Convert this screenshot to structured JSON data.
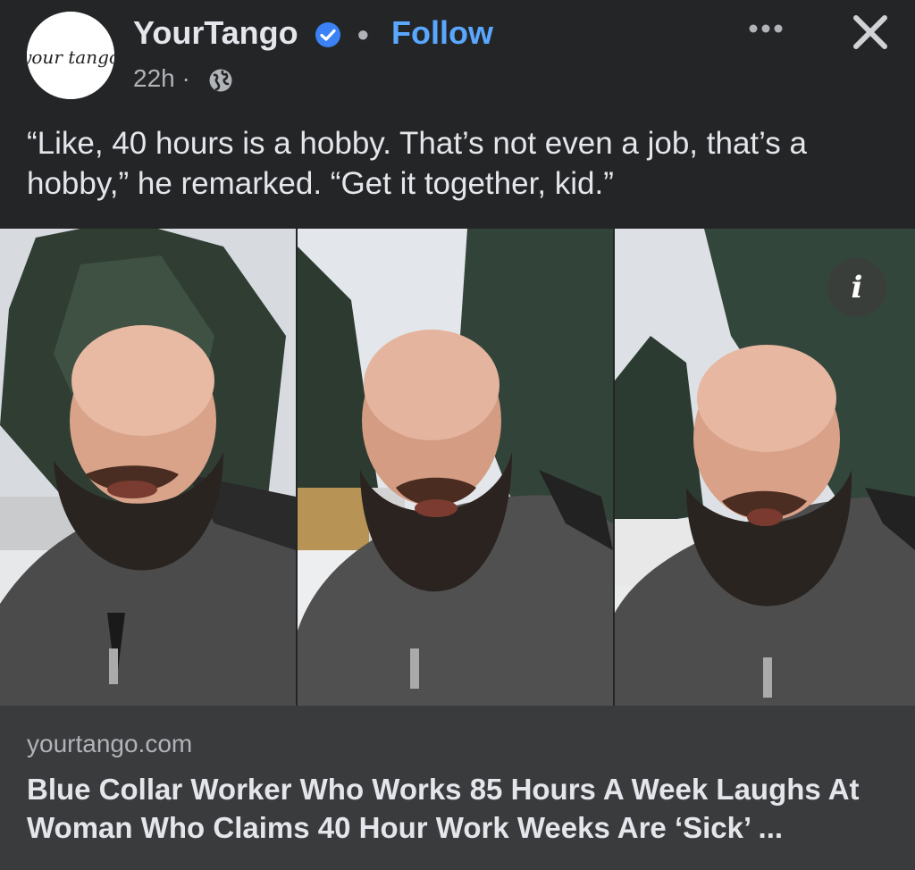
{
  "post": {
    "page_name": "YourTango",
    "follow_label": "Follow",
    "separator": "•",
    "time": "22h ·",
    "logo_text": "your tango",
    "caption": "“Like, 40 hours is a hobby. That’s not even a job, that’s a hobby,” he remarked. “Get it together, kid.”",
    "icons": {
      "verified": "verified-badge-icon",
      "audience": "globe-icon",
      "more": "more-options-icon",
      "close": "close-icon",
      "info": "info-icon"
    },
    "info_glyph": "i"
  },
  "link": {
    "domain": "yourtango.com",
    "headline": "Blue Collar Worker Who Works 85 Hours A Week Laughs At Woman Who Claims 40 Hour Work Weeks Are ‘Sick’ ..."
  },
  "colors": {
    "background": "#242526",
    "link_card": "#3a3b3c",
    "follow": "#5aa7ff",
    "verified": "#3b82f6"
  }
}
